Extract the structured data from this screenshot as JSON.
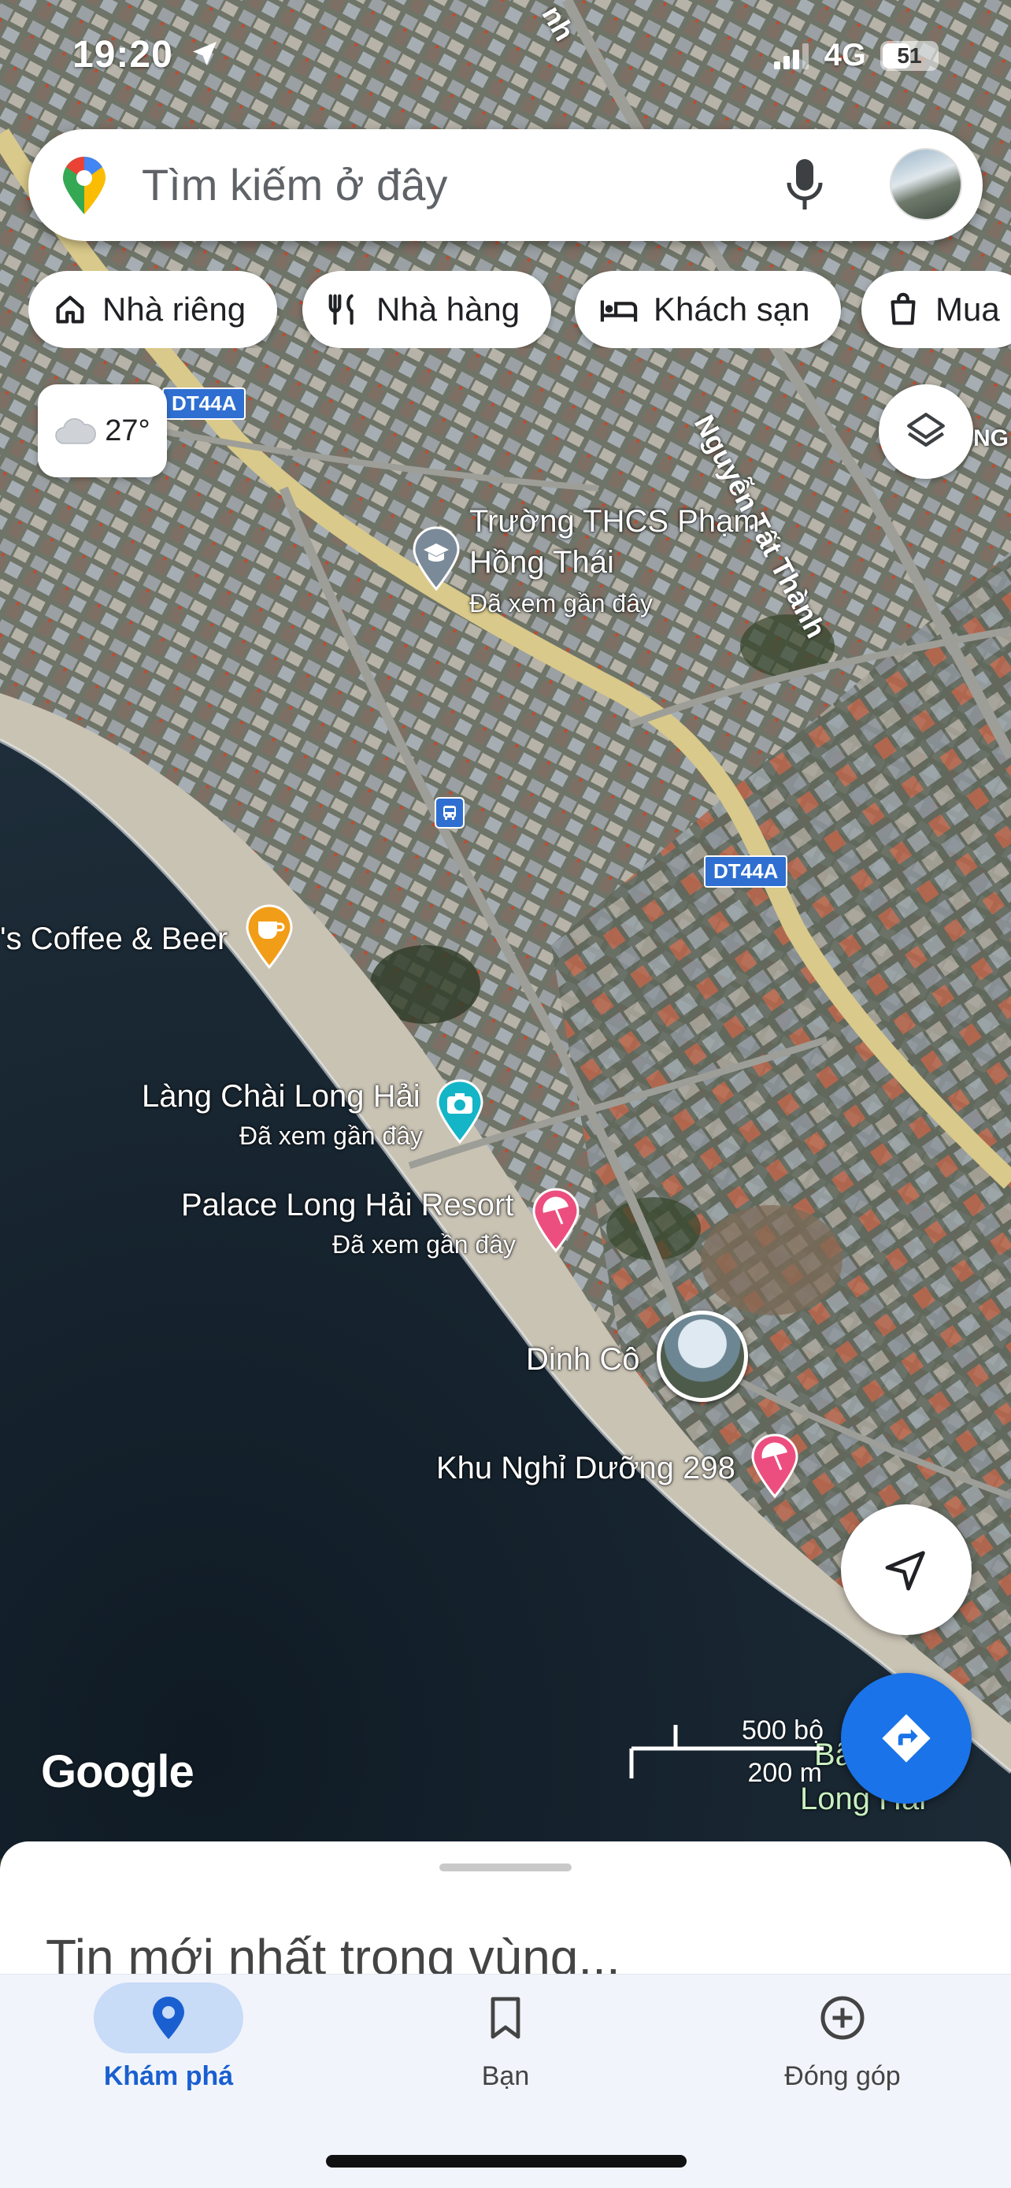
{
  "status_bar": {
    "time": "19:20",
    "network": "4G",
    "battery": "51",
    "battery_level": 0.51,
    "location_icon": "location-arrow-icon",
    "signal_icon": "signal-bars-icon"
  },
  "search": {
    "placeholder": "Tìm kiếm ở đây",
    "pin_icon": "google-maps-pin-icon",
    "mic_icon": "microphone-icon",
    "avatar": "profile-avatar"
  },
  "chips": [
    {
      "label": "Nhà riêng",
      "icon": "home-icon"
    },
    {
      "label": "Nhà hàng",
      "icon": "restaurant-icon"
    },
    {
      "label": "Khách sạn",
      "icon": "hotel-icon"
    },
    {
      "label": "Mua",
      "icon": "shopping-bag-icon"
    }
  ],
  "weather": {
    "temp": "27°",
    "icon": "cloud-icon"
  },
  "map": {
    "road_shields": [
      "DT44A",
      "DT44A"
    ],
    "road_names": [
      "Nguyễn Tất Thành",
      "nh",
      "NG"
    ],
    "places": [
      {
        "name": "Trường THCS Phạm",
        "name2": "Hồng Thái",
        "sub": "Đã xem gần đây",
        "icon": "school-icon"
      },
      {
        "name": "'s Coffee & Beer",
        "icon": "cafe-icon"
      },
      {
        "name": "Làng Chài Long Hải",
        "sub": "Đã xem gần đây",
        "icon": "camera-icon"
      },
      {
        "name": "Palace Long Hải Resort",
        "sub": "Đã xem gần đây",
        "icon": "beach-umbrella-icon"
      },
      {
        "name": "Dinh Cô",
        "icon": "photo-thumbnail"
      },
      {
        "name": "Khu Nghỉ Dưỡng 298",
        "icon": "beach-umbrella-icon"
      },
      {
        "name": "Bã",
        "name2": "Long Hải",
        "icon": "pin-icon"
      }
    ],
    "bus_icon": "bus-stop-icon",
    "google_logo": "Google",
    "scale": {
      "top": "500 bộ",
      "bottom": "200 m"
    }
  },
  "buttons": {
    "layers_icon": "layers-icon",
    "locate_icon": "navigation-arrow-icon",
    "directions_icon": "directions-icon"
  },
  "sheet": {
    "title": "Tin mới nhất trong vùng..."
  },
  "bottom_nav": [
    {
      "label": "Khám phá",
      "icon": "explore-pin-icon",
      "active": true
    },
    {
      "label": "Bạn",
      "icon": "bookmark-icon",
      "active": false
    },
    {
      "label": "Đóng góp",
      "icon": "add-circle-icon",
      "active": false
    }
  ],
  "colors": {
    "accent": "#1a73e8",
    "nav_active_bg": "#c8dbf7",
    "road_yellow": "#d9c98a"
  }
}
